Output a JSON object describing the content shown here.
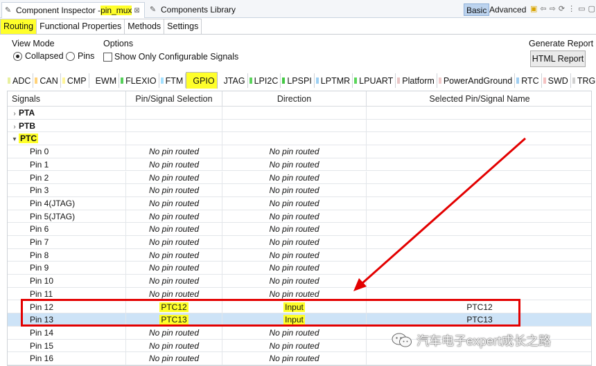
{
  "titlebar": {
    "tab1_prefix": "Component Inspector - ",
    "tab1_highlight": "pin_mux",
    "tab1_close": "⊠",
    "tab2_label": "Components Library",
    "mode_basic": "Basic",
    "mode_advanced": "Advanced"
  },
  "subtabs": [
    "Routing",
    "Functional Properties",
    "Methods",
    "Settings"
  ],
  "options": {
    "view_mode_title": "View Mode",
    "radio_collapsed": "Collapsed",
    "radio_pins": "Pins",
    "options_title": "Options",
    "checkbox_label": "Show Only Configurable Signals",
    "generate_report": "Generate Report",
    "html_report_button": "HTML Report"
  },
  "peripheral_tabs": [
    {
      "label": "ADC",
      "color": "#e8f0a0"
    },
    {
      "label": "CAN",
      "color": "#ffd27a"
    },
    {
      "label": "CMP",
      "color": "#fff59a"
    },
    {
      "label": "EWM",
      "color": "#ffffff"
    },
    {
      "label": "FLEXIO",
      "color": "#55d05a"
    },
    {
      "label": "FTM",
      "color": "#a3e0ff"
    },
    {
      "label": "GPIO",
      "color": "#ffff2a"
    },
    {
      "label": "JTAG",
      "color": "#ffffff"
    },
    {
      "label": "LPI2C",
      "color": "#5cd45c"
    },
    {
      "label": "LPSPI",
      "color": "#43c844"
    },
    {
      "label": "LPTMR",
      "color": "#9ccff2"
    },
    {
      "label": "LPUART",
      "color": "#5ad55a"
    },
    {
      "label": "Platform",
      "color": "#e8c4c4"
    },
    {
      "label": "PowerAndGround",
      "color": "#f0c8c8"
    },
    {
      "label": "RTC",
      "color": "#9fcdf0"
    },
    {
      "label": "SWD",
      "color": "#f5c2c2"
    },
    {
      "label": "TRGMUX",
      "color": "#d0d0d0"
    }
  ],
  "table": {
    "headers": [
      "Signals",
      "Pin/Signal Selection",
      "Direction",
      "Selected Pin/Signal Name"
    ],
    "groups": [
      {
        "label": "PTA",
        "expanded": false
      },
      {
        "label": "PTB",
        "expanded": false
      },
      {
        "label": "PTC",
        "expanded": true
      }
    ],
    "rows": [
      {
        "signal": "Pin 0",
        "pin": "No pin routed",
        "dir": "No pin routed",
        "name": ""
      },
      {
        "signal": "Pin 1",
        "pin": "No pin routed",
        "dir": "No pin routed",
        "name": ""
      },
      {
        "signal": "Pin 2",
        "pin": "No pin routed",
        "dir": "No pin routed",
        "name": ""
      },
      {
        "signal": "Pin 3",
        "pin": "No pin routed",
        "dir": "No pin routed",
        "name": ""
      },
      {
        "signal": "Pin 4(JTAG)",
        "pin": "No pin routed",
        "dir": "No pin routed",
        "name": ""
      },
      {
        "signal": "Pin 5(JTAG)",
        "pin": "No pin routed",
        "dir": "No pin routed",
        "name": ""
      },
      {
        "signal": "Pin 6",
        "pin": "No pin routed",
        "dir": "No pin routed",
        "name": ""
      },
      {
        "signal": "Pin 7",
        "pin": "No pin routed",
        "dir": "No pin routed",
        "name": ""
      },
      {
        "signal": "Pin 8",
        "pin": "No pin routed",
        "dir": "No pin routed",
        "name": ""
      },
      {
        "signal": "Pin 9",
        "pin": "No pin routed",
        "dir": "No pin routed",
        "name": ""
      },
      {
        "signal": "Pin 10",
        "pin": "No pin routed",
        "dir": "No pin routed",
        "name": ""
      },
      {
        "signal": "Pin 11",
        "pin": "No pin routed",
        "dir": "No pin routed",
        "name": ""
      },
      {
        "signal": "Pin 12",
        "pin": "PTC12",
        "dir": "Input",
        "name": "PTC12"
      },
      {
        "signal": "Pin 13",
        "pin": "PTC13",
        "dir": "Input",
        "name": "PTC13"
      },
      {
        "signal": "Pin 14",
        "pin": "No pin routed",
        "dir": "No pin routed",
        "name": ""
      },
      {
        "signal": "Pin 15",
        "pin": "No pin routed",
        "dir": "No pin routed",
        "name": ""
      },
      {
        "signal": "Pin 16",
        "pin": "No pin routed",
        "dir": "No pin routed",
        "name": ""
      }
    ]
  },
  "watermark": "汽车电子expert成长之路",
  "colors": {
    "highlight": "#ffff2a",
    "annotation_red": "#e30000",
    "selected_row": "#cde3f7"
  }
}
